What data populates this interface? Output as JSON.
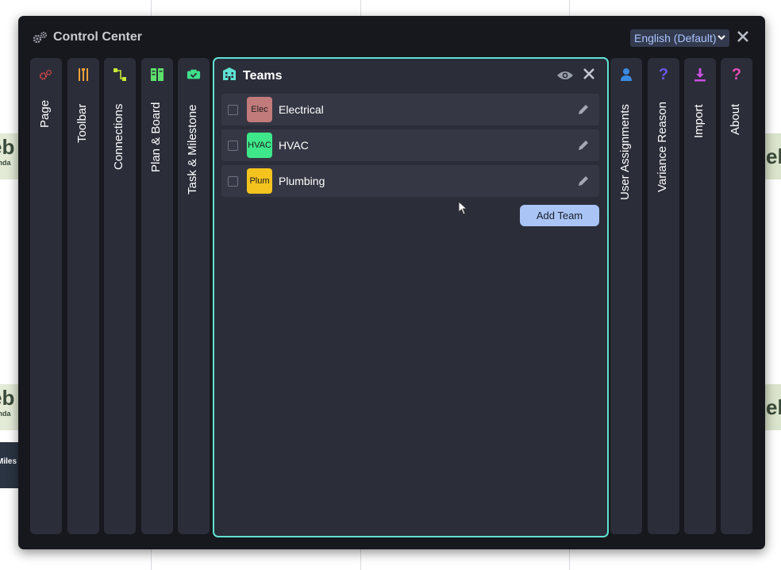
{
  "background": {
    "day_text_partial": "eb",
    "day_subtext_partial": "onda",
    "milestone_text_partial": "Miles"
  },
  "control_center": {
    "title": "Control Center",
    "language": "English (Default)",
    "close_glyph": "✕",
    "left_tabs": [
      {
        "label": "Page",
        "icon": "gears-icon",
        "color": "#e24a4a"
      },
      {
        "label": "Toolbar",
        "icon": "tools-icon",
        "color": "#f2a13a"
      },
      {
        "label": "Connections",
        "icon": "connections-icon",
        "color": "#c8e83a"
      },
      {
        "label": "Plan & Board",
        "icon": "board-icon",
        "color": "#5de06b"
      },
      {
        "label": "Task & Milestone",
        "icon": "task-icon",
        "color": "#3fe08a"
      }
    ],
    "right_tabs": [
      {
        "label": "User Assignments",
        "icon": "user-icon",
        "color": "#3a8be0"
      },
      {
        "label": "Variance Reason",
        "icon": "question-icon",
        "color": "#6c56e8"
      },
      {
        "label": "Import",
        "icon": "download-icon",
        "color": "#c94fe0"
      },
      {
        "label": "About",
        "icon": "question-icon",
        "color": "#e04fb5"
      }
    ]
  },
  "teams_panel": {
    "title": "Teams",
    "icon": "building-icon",
    "accent": "#5fe3d3",
    "close_glyph": "✕",
    "teams": [
      {
        "badge": "Elec",
        "name": "Electrical",
        "color": "#c27b7b"
      },
      {
        "badge": "HVAC",
        "name": "HVAC",
        "color": "#3ee88a"
      },
      {
        "badge": "Plum",
        "name": "Plumbing",
        "color": "#f5c31e"
      }
    ],
    "add_button": "Add Team"
  }
}
